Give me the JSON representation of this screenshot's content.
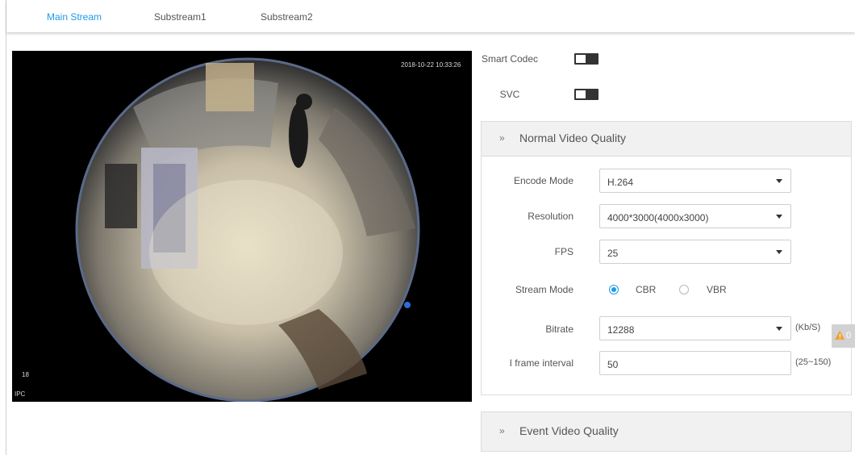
{
  "tabs": [
    "Main Stream",
    "Substream1",
    "Substream2"
  ],
  "video": {
    "timestamp": "2018-10-22 10:33:26",
    "channel": "18",
    "device": "IPC"
  },
  "smart_codec": {
    "label": "Smart Codec",
    "enabled": false
  },
  "svc": {
    "label": "SVC",
    "enabled": false
  },
  "normal_quality": {
    "title": "Normal Video Quality",
    "encode_mode": {
      "label": "Encode Mode",
      "value": "H.264"
    },
    "resolution": {
      "label": "Resolution",
      "value": "4000*3000(4000x3000)"
    },
    "fps": {
      "label": "FPS",
      "value": "25"
    },
    "stream_mode": {
      "label": "Stream Mode",
      "options": [
        "CBR",
        "VBR"
      ],
      "selected": "CBR"
    },
    "bitrate": {
      "label": "Bitrate",
      "value": "12288",
      "unit": "(Kb/S)"
    },
    "iframe": {
      "label": "I frame interval",
      "value": "50",
      "range": "(25~150)"
    }
  },
  "event_quality": {
    "title": "Event Video Quality"
  },
  "alert_count": "0",
  "colors": {
    "accent": "#1e9be6",
    "warning": "#f0a030"
  }
}
